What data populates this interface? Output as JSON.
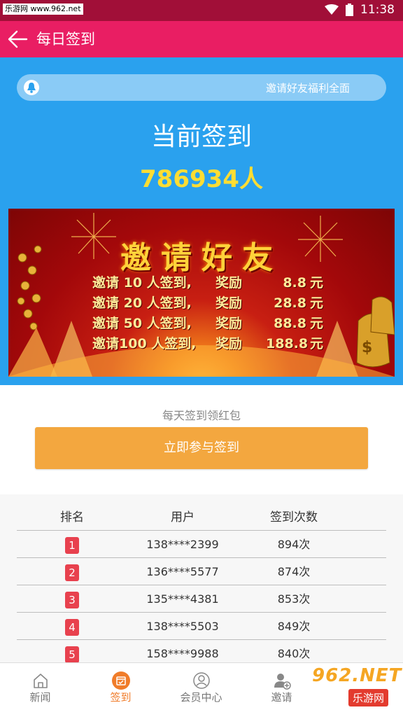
{
  "status_bar": {
    "watermark": "乐游网 www.962.net",
    "time": "11:38",
    "bg_color": "#a10f38"
  },
  "app_bar": {
    "title": "每日签到",
    "back_icon": "arrow-left-icon",
    "bg_color": "#e91e63"
  },
  "hero": {
    "bg_color": "#2aa1ee",
    "notice_icon": "bell-icon",
    "notice_text": "邀请好友福利全面",
    "checkin_title": "当前签到",
    "checkin_count": "786934人",
    "count_color": "#ffdd33"
  },
  "banner": {
    "title": "邀请好友",
    "rows": [
      {
        "invite": "邀请 10 人签到,",
        "reward": "奖励",
        "amount": "8.8",
        "unit": "元"
      },
      {
        "invite": "邀请 20 人签到,",
        "reward": "奖励",
        "amount": "28.8",
        "unit": "元"
      },
      {
        "invite": "邀请 50 人签到,",
        "reward": "奖励",
        "amount": "88.8",
        "unit": "元"
      },
      {
        "invite": "邀请100 人签到,",
        "reward": "奖励",
        "amount": "188.8",
        "unit": "元"
      }
    ]
  },
  "subtitle": "每天签到领红包",
  "join_button": {
    "label": "立即参与签到",
    "color": "#f3a73f"
  },
  "ranking": {
    "headers": [
      "排名",
      "用户",
      "签到次数"
    ],
    "rows": [
      {
        "rank": "1",
        "user": "138****2399",
        "count": "894次"
      },
      {
        "rank": "2",
        "user": "136****5577",
        "count": "874次"
      },
      {
        "rank": "3",
        "user": "135****4381",
        "count": "853次"
      },
      {
        "rank": "4",
        "user": "138****5503",
        "count": "849次"
      },
      {
        "rank": "5",
        "user": "158****9988",
        "count": "840次"
      }
    ],
    "badge_color": "#e8414e"
  },
  "tab_bar": {
    "tabs": [
      {
        "label": "新闻",
        "icon": "home-icon"
      },
      {
        "label": "签到",
        "icon": "calendar-check-icon",
        "active": true
      },
      {
        "label": "会员中心",
        "icon": "user-circle-icon"
      },
      {
        "label": "邀请",
        "icon": "add-user-icon"
      }
    ],
    "active_color": "#f07c2a"
  },
  "watermark_bottom": {
    "number": "962.NET",
    "site": "乐游网"
  }
}
